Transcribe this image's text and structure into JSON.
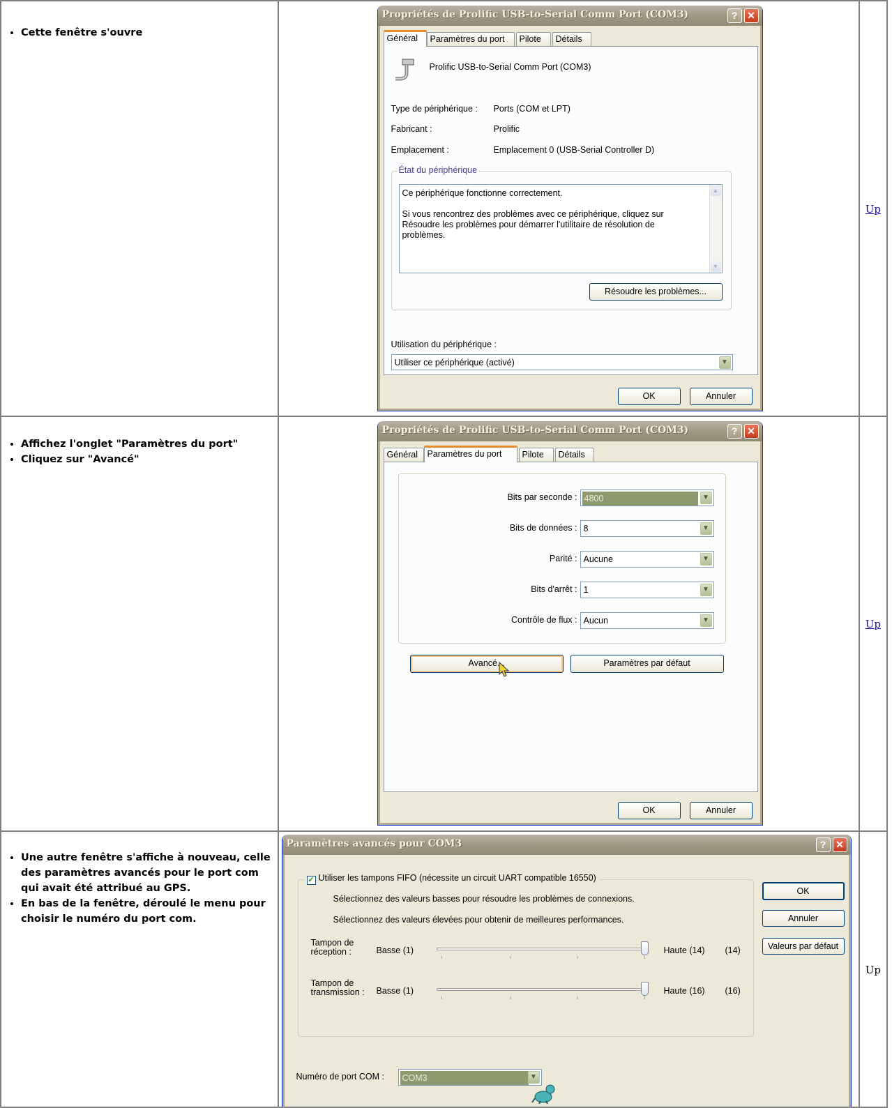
{
  "rows": [
    {
      "bullets": [
        "Cette fenêtre s'ouvre"
      ],
      "up": "Up",
      "window": {
        "title": "Propriétés de Prolific USB-to-Serial Comm Port (COM3)",
        "tabs": [
          "Général",
          "Paramètres du port",
          "Pilote",
          "Détails"
        ],
        "active_tab": "Général",
        "device_name": "Prolific USB-to-Serial Comm Port (COM3)",
        "props": [
          {
            "label": "Type de périphérique :",
            "value": "Ports (COM et LPT)"
          },
          {
            "label": "Fabricant :",
            "value": "Prolific"
          },
          {
            "label": "Emplacement :",
            "value": "Emplacement 0 (USB-Serial Controller D)"
          }
        ],
        "status_group": "État du périphérique",
        "status_line1": "Ce périphérique fonctionne correctement.",
        "status_line2": "Si vous rencontrez des problèmes avec ce périphérique, cliquez sur",
        "status_line3": "Résoudre les problèmes pour démarrer l'utilitaire de résolution de",
        "status_line4": "problèmes.",
        "troubleshoot_button": "Résoudre les problèmes...",
        "usage_label": "Utilisation du périphérique :",
        "usage_value": "Utiliser ce périphérique (activé)",
        "ok": "OK",
        "cancel": "Annuler"
      }
    },
    {
      "bullets": [
        "Affichez l'onglet \"Paramètres du port\"",
        "Cliquez sur \"Avancé\""
      ],
      "up": "Up",
      "window": {
        "title": "Propriétés de Prolific USB-to-Serial Comm Port (COM3)",
        "tabs": [
          "Général",
          "Paramètres du port",
          "Pilote",
          "Détails"
        ],
        "active_tab": "Paramètres du port",
        "fields": [
          {
            "label": "Bits par seconde :",
            "value": "4800"
          },
          {
            "label": "Bits de données :",
            "value": "8"
          },
          {
            "label": "Parité :",
            "value": "Aucune"
          },
          {
            "label": "Bits d'arrêt :",
            "value": "1"
          },
          {
            "label": "Contrôle de flux :",
            "value": "Aucun"
          }
        ],
        "advanced_button": "Avancé...",
        "defaults_button": "Paramètres par défaut",
        "ok": "OK",
        "cancel": "Annuler"
      }
    },
    {
      "bullets": [
        "Une autre fenêtre s'affiche à nouveau, celle des paramètres avancés pour le port com qui avait été attribué au GPS.",
        "En bas de la fenêtre, déroulé le menu pour choisir le numéro du port com."
      ],
      "up": "Up",
      "window": {
        "title": "Paramètres avancés pour COM3",
        "fifo_label": "Utiliser les tampons FIFO (nécessite un circuit UART compatible 16550)",
        "fifo_checked": true,
        "hint_low": "Sélectionnez des valeurs basses pour résoudre les problèmes de connexions.",
        "hint_high": "Sélectionnez des valeurs élevées pour obtenir de meilleures performances.",
        "rx_label_1": "Tampon de",
        "rx_label_2": "réception :",
        "rx_low": "Basse (1)",
        "rx_high": "Haute (14)",
        "rx_value": "(14)",
        "tx_label_1": "Tampon de",
        "tx_label_2": "transmission :",
        "tx_low": "Basse (1)",
        "tx_high": "Haute (16)",
        "tx_value": "(16)",
        "com_label": "Numéro de port COM :",
        "com_value": "COM3",
        "ok": "OK",
        "cancel": "Annuler",
        "defaults": "Valeurs par défaut"
      }
    }
  ]
}
